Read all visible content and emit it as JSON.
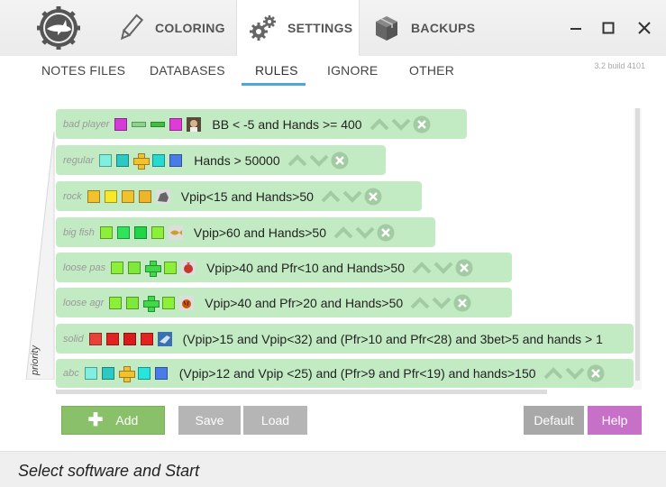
{
  "top_tabs": [
    {
      "label": "COLORING",
      "icon": "pencil-icon"
    },
    {
      "label": "SETTINGS",
      "icon": "gears-icon",
      "active": true
    },
    {
      "label": "BACKUPS",
      "icon": "box-icon"
    }
  ],
  "window_controls": {
    "minimize": "—",
    "maximize": "☐",
    "close": "✕"
  },
  "sub_tabs": [
    {
      "label": "NOTES FILES"
    },
    {
      "label": "DATABASES"
    },
    {
      "label": "RULES",
      "active": true
    },
    {
      "label": "IGNORE"
    },
    {
      "label": "OTHER"
    }
  ],
  "version": "3.2 build 4101",
  "priority_label": "priority",
  "rules": [
    {
      "name": "bad player",
      "condition": "BB < -5 and Hands >= 400"
    },
    {
      "name": "regular",
      "condition": "Hands > 50000"
    },
    {
      "name": "rock",
      "condition": "Vpip<15 and Hands>50"
    },
    {
      "name": "big fish",
      "condition": "Vpip>60 and Hands>50"
    },
    {
      "name": "loose pas",
      "condition": "Vpip>40 and Pfr<10 and Hands>50"
    },
    {
      "name": "loose agr",
      "condition": "Vpip>40 and Pfr>20 and Hands>50"
    },
    {
      "name": "solid",
      "condition": "(Vpip>15 and Vpip<32) and (Pfr>10 and Pfr<28) and 3bet>5 and hands > 1"
    },
    {
      "name": "abc",
      "condition": "(Vpip>12 and Vpip <25) and (Pfr>9 and Pfr<19) and hands>150"
    }
  ],
  "buttons": {
    "add": "Add",
    "save": "Save",
    "load": "Load",
    "default": "Default",
    "help": "Help"
  },
  "status_text": "Select software and Start",
  "colors": {
    "rule_bg": "#c3ebc3",
    "accent": "#4fa6d4",
    "add": "#8bc06a",
    "help": "#c670c7"
  }
}
